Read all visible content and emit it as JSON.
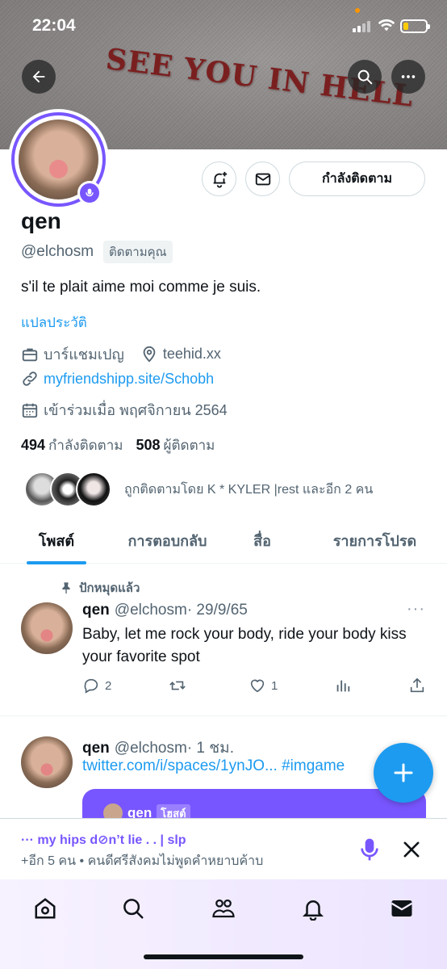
{
  "status": {
    "time": "22:04"
  },
  "banner": {
    "text": "SEE YOU IN HELL"
  },
  "profile": {
    "name": "qen",
    "handle": "@elchosm",
    "follows_you": "ติดตามคุณ",
    "following_button": "กำลังติดตาม",
    "bio": "s'il te plait aime moi comme je suis.",
    "translate": "แปลประวัติ",
    "category": "บาร์แชมเปญ",
    "location": "teehid.xx",
    "website": "myfriendshipp.site/Schobh",
    "joined": "เข้าร่วมเมื่อ พฤศจิกายน 2564",
    "following_count": "494",
    "following_label": "กำลังติดตาม",
    "followers_count": "508",
    "followers_label": "ผู้ติดตาม",
    "followed_by": "ถูกติดตามโดย K * KYLER |rest และอีก 2 คน"
  },
  "tabs": [
    "โพสต์",
    "การตอบกลับ",
    "สื่อ",
    "รายการโปรด"
  ],
  "pinned_label": "ปักหมุดแล้ว",
  "tweets": [
    {
      "name": "qen",
      "handle": "@elchosm",
      "time": "· 29/9/65",
      "text": "Baby, let me rock your body, ride your body kiss your favorite spot",
      "replies": "2",
      "retweets": "",
      "likes": "1"
    },
    {
      "name": "qen",
      "handle": "@elchosm",
      "time": "· 1 ชม.",
      "link": "twitter.com/i/spaces/1ynJO... #imgame",
      "space_host_name": "qen",
      "space_host_tag": "โฮสต์"
    }
  ],
  "more_icon": "···",
  "dock": {
    "title": "··· my hips d⊘n’t lie . . | slp",
    "subtitle": "+อีก 5 คน • คนดีศรีสังคมไม่พูดคำหยาบค้าบ"
  },
  "colors": {
    "accent": "#1d9bf0",
    "spaces_purple": "#7856ff",
    "text": "#0f1419",
    "secondary": "#536471"
  }
}
